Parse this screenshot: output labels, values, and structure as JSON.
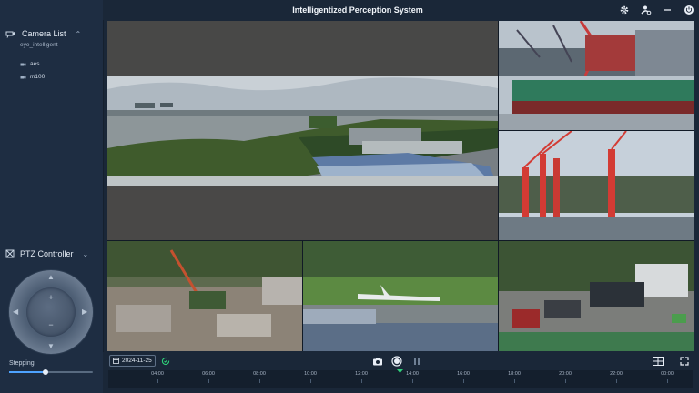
{
  "app": {
    "title": "Intelligentized Perception System"
  },
  "sidebar": {
    "camera_list": {
      "label": "Camera List",
      "group": "eye_intelligent",
      "items": [
        {
          "label": "aes"
        },
        {
          "label": "m100"
        }
      ]
    },
    "ptz": {
      "label": "PTZ Controller",
      "zoom_in": "+",
      "zoom_out": "−"
    },
    "stepping": {
      "label": "Stepping",
      "value": 0.43
    }
  },
  "bottom": {
    "date": "2024-11-25",
    "timeline": {
      "ticks": [
        "04:00",
        "06:00",
        "08:00",
        "10:00",
        "12:00",
        "14:00",
        "16:00",
        "18:00",
        "20:00",
        "22:00",
        "00:00"
      ]
    }
  },
  "icons": {
    "top": [
      "settings-icon",
      "user-settings-icon",
      "minimize-icon",
      "power-icon"
    ],
    "bottom": [
      "calendar-icon",
      "sync-icon",
      "snapshot-icon",
      "record-icon",
      "pause-icon",
      "grid-layout-icon",
      "fullscreen-icon"
    ]
  },
  "colors": {
    "accent": "#4ea3ff",
    "playhead": "#2fd17a",
    "background": "#1a2738",
    "sidebar": "#1e2d42"
  }
}
